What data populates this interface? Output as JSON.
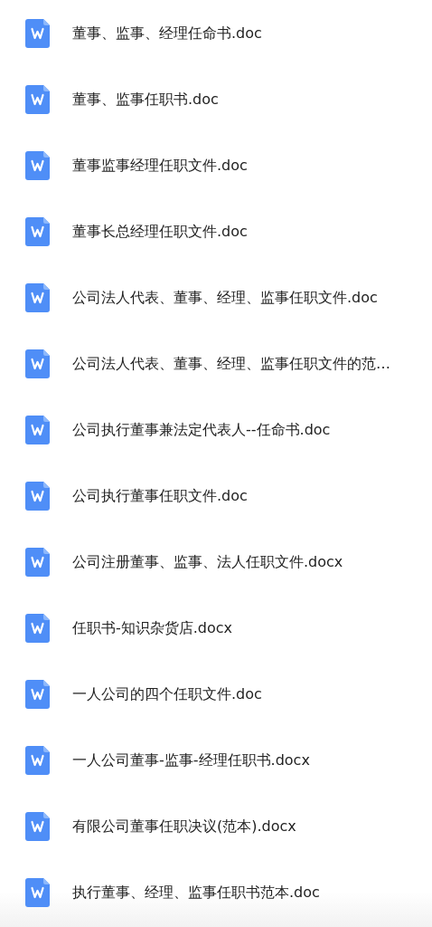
{
  "files": [
    {
      "name": "董事、监事、经理任命书.doc"
    },
    {
      "name": "董事、监事任职书.doc"
    },
    {
      "name": "董事监事经理任职文件.doc"
    },
    {
      "name": "董事长总经理任职文件.doc"
    },
    {
      "name": "公司法人代表、董事、经理、监事任职文件.doc"
    },
    {
      "name": "公司法人代表、董事、经理、监事任职文件的范…"
    },
    {
      "name": "公司执行董事兼法定代表人--任命书.doc"
    },
    {
      "name": "公司执行董事任职文件.doc"
    },
    {
      "name": "公司注册董事、监事、法人任职文件.docx"
    },
    {
      "name": "任职书-知识杂货店.docx"
    },
    {
      "name": "一人公司的四个任职文件.doc"
    },
    {
      "name": "一人公司董事-监事-经理任职书.docx"
    },
    {
      "name": "有限公司董事任职决议(范本).docx"
    },
    {
      "name": "执行董事、经理、监事任职书范本.doc"
    }
  ]
}
